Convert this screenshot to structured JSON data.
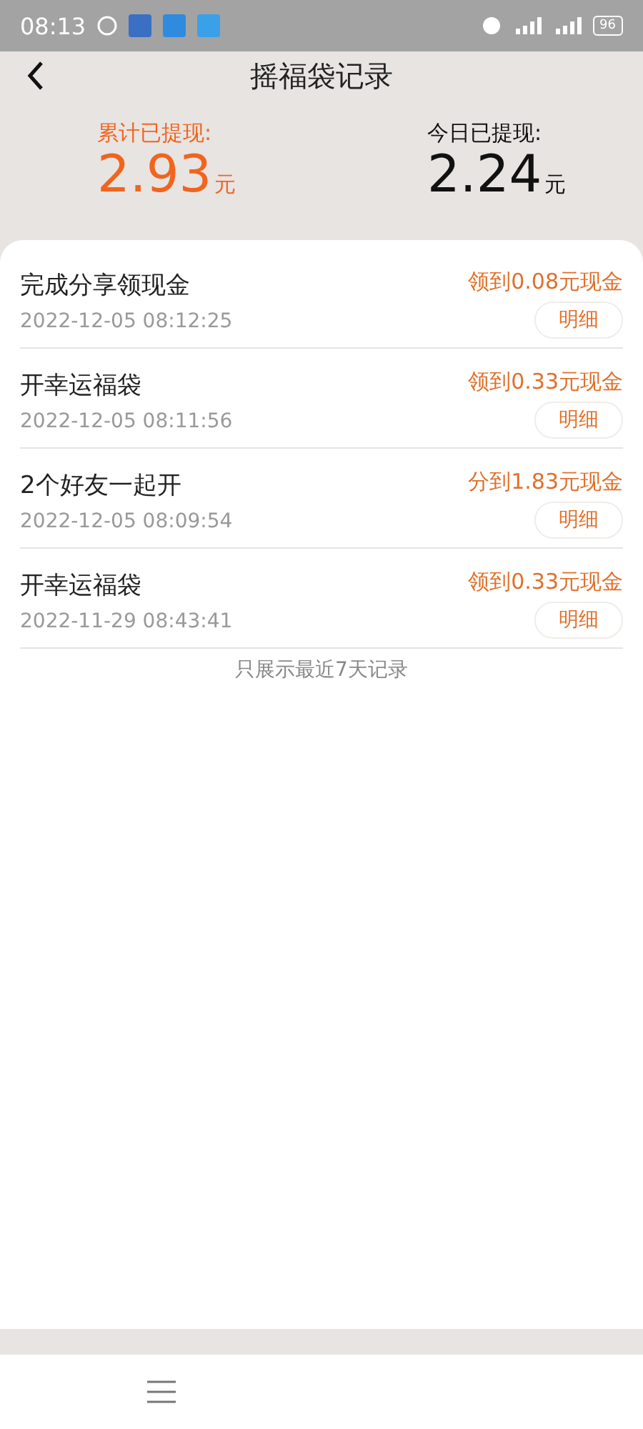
{
  "status_bar": {
    "time": "08:13",
    "battery": "96"
  },
  "header": {
    "title": "摇福袋记录"
  },
  "summary": [
    {
      "label": "累计已提现:",
      "amount": "2.93",
      "unit": "元",
      "highlight": true
    },
    {
      "label": "今日已提现:",
      "amount": "2.24",
      "unit": "元",
      "highlight": false
    }
  ],
  "records": [
    {
      "title": "完成分享领现金",
      "time": "2022-12-05 08:12:25",
      "reward": "领到0.08元现金",
      "button": "明细"
    },
    {
      "title": "开幸运福袋",
      "time": "2022-12-05 08:11:56",
      "reward": "领到0.33元现金",
      "button": "明细"
    },
    {
      "title": "2个好友一起开",
      "time": "2022-12-05 08:09:54",
      "reward": "分到1.83元现金",
      "button": "明细"
    },
    {
      "title": "开幸运福袋",
      "time": "2022-11-29 08:43:41",
      "reward": "领到0.33元现金",
      "button": "明细"
    }
  ],
  "footer_note": "只展示最近7天记录"
}
